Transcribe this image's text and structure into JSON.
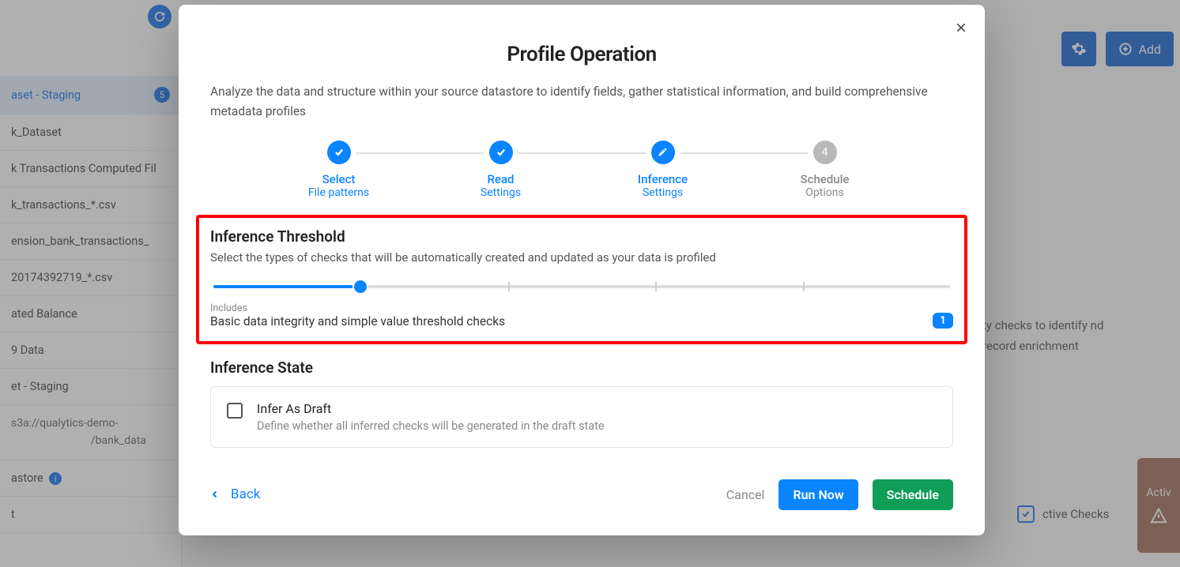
{
  "sidebar": {
    "active": {
      "label": "aset - Staging",
      "badge": "5"
    },
    "items": [
      "k_Dataset",
      "k Transactions Computed Fil",
      "k_transactions_*.csv",
      "ension_bank_transactions_",
      "20174392719_*.csv",
      "ated Balance",
      "9 Data",
      "et - Staging"
    ],
    "path1": "s3a://qualytics-demo-",
    "path2": "/bank_data",
    "astore": "astore",
    "tail": "t"
  },
  "topbar": {
    "add": "Add"
  },
  "bgRight": "ty checks to identify nd record enrichment",
  "bottom": {
    "activeChecks": "ctive Checks",
    "dash": "–"
  },
  "rightTab": "Activ",
  "modal": {
    "title": "Profile Operation",
    "subtitle": "Analyze the data and structure within your source datastore to identify fields, gather statistical information, and build comprehensive metadata profiles",
    "steps": [
      {
        "l1": "Select",
        "l2": "File patterns",
        "icon": "check",
        "state": "done"
      },
      {
        "l1": "Read",
        "l2": "Settings",
        "icon": "check",
        "state": "done"
      },
      {
        "l1": "Inference",
        "l2": "Settings",
        "icon": "edit",
        "state": "active"
      },
      {
        "l1": "Schedule",
        "l2": "Options",
        "icon": "4",
        "state": "inactive"
      }
    ],
    "threshold": {
      "title": "Inference Threshold",
      "sub": "Select the types of checks that will be automatically created and updated as your data is profiled",
      "includesLabel": "Includes",
      "includesText": "Basic data integrity and simple value threshold checks",
      "count": "1",
      "sliderPercent": 20
    },
    "state": {
      "title": "Inference State",
      "cardTitle": "Infer As Draft",
      "cardSub": "Define whether all inferred checks will be generated in the draft state"
    },
    "footer": {
      "back": "Back",
      "cancel": "Cancel",
      "run": "Run Now",
      "schedule": "Schedule"
    }
  }
}
